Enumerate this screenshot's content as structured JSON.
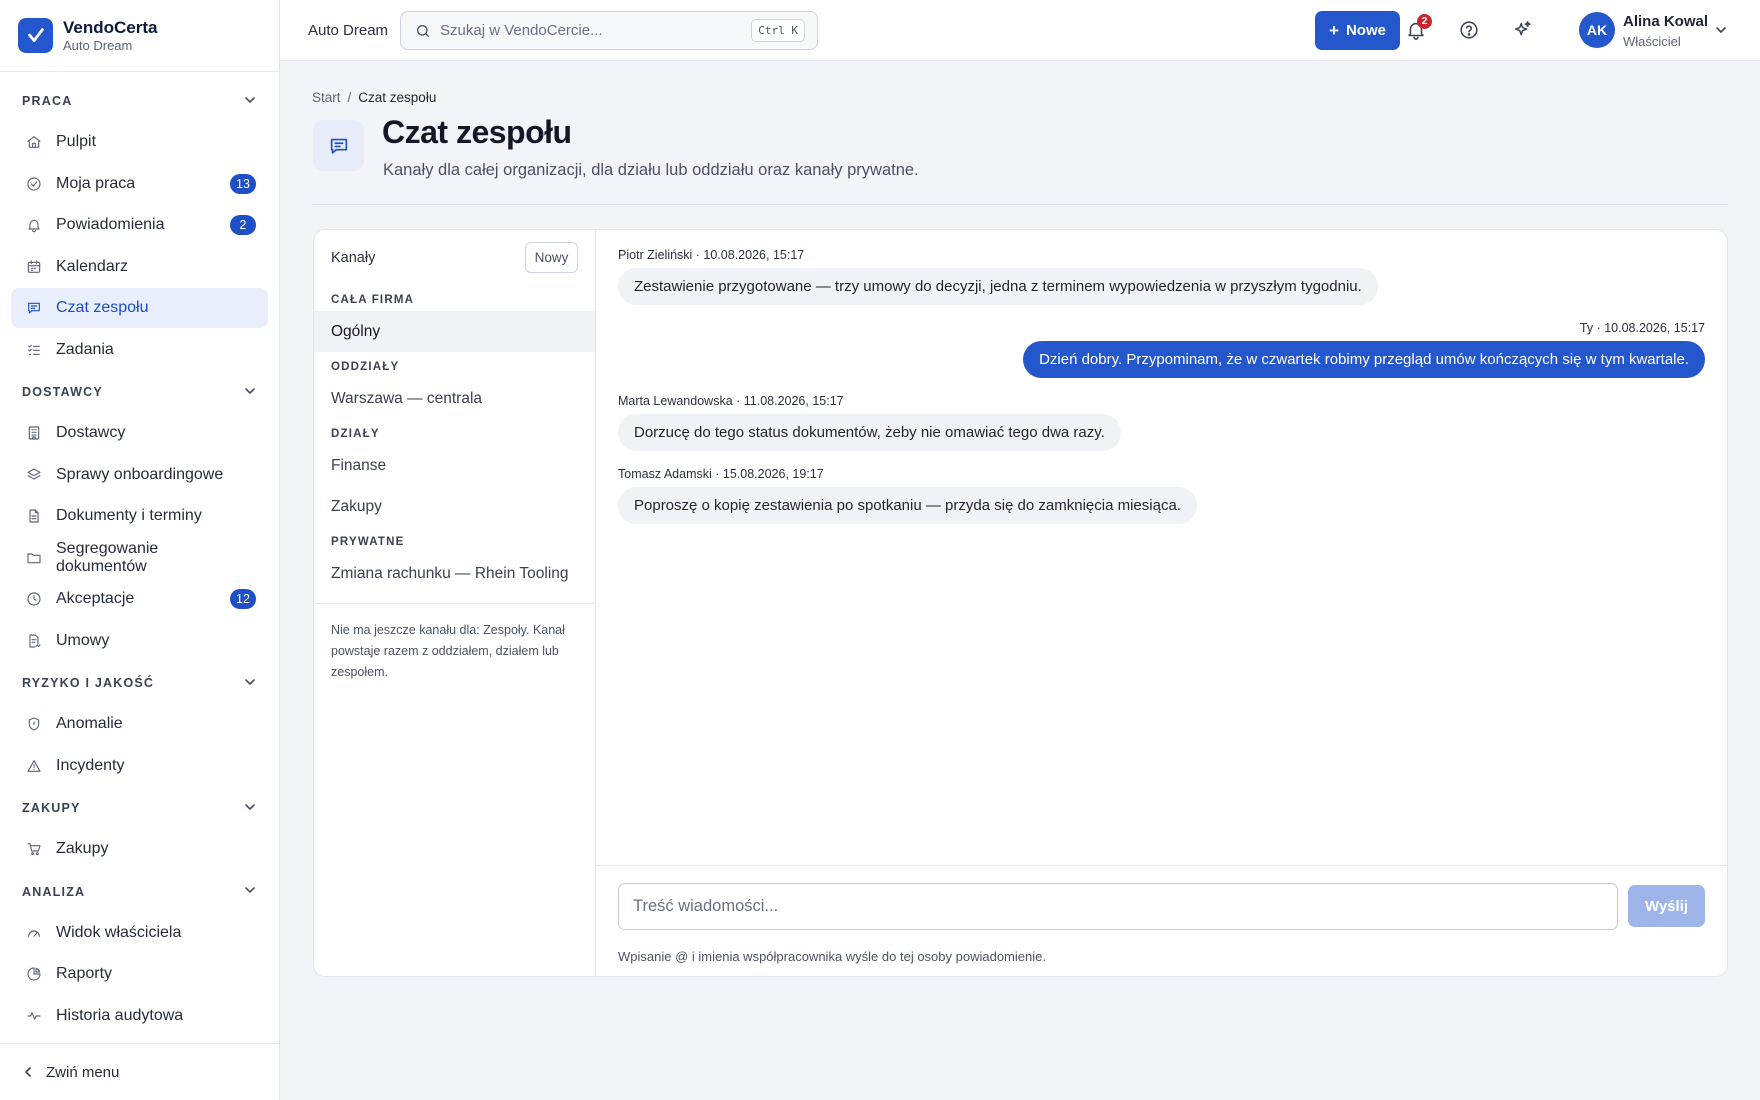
{
  "brand": {
    "name": "VendoCerta",
    "org": "Auto Dream"
  },
  "sidebar": {
    "sections": [
      {
        "label": "PRACA",
        "items": [
          {
            "label": "Pulpit",
            "icon": "home-icon"
          },
          {
            "label": "Moja praca",
            "icon": "check-circle-icon",
            "badge": "13"
          },
          {
            "label": "Powiadomienia",
            "icon": "bell-icon",
            "badge": "2"
          },
          {
            "label": "Kalendarz",
            "icon": "calendar-icon"
          },
          {
            "label": "Czat zespołu",
            "icon": "chat-icon",
            "active": true
          },
          {
            "label": "Zadania",
            "icon": "list-check-icon"
          }
        ]
      },
      {
        "label": "DOSTAWCY",
        "items": [
          {
            "label": "Dostawcy",
            "icon": "building-icon"
          },
          {
            "label": "Sprawy onboardingowe",
            "icon": "layers-icon"
          },
          {
            "label": "Dokumenty i terminy",
            "icon": "document-icon"
          },
          {
            "label": "Segregowanie dokumentów",
            "icon": "folder-icon"
          },
          {
            "label": "Akceptacje",
            "icon": "clock-icon",
            "badge": "12"
          },
          {
            "label": "Umowy",
            "icon": "contract-icon"
          }
        ]
      },
      {
        "label": "RYZYKO I JAKOŚĆ",
        "items": [
          {
            "label": "Anomalie",
            "icon": "shield-icon"
          },
          {
            "label": "Incydenty",
            "icon": "warning-icon"
          }
        ]
      },
      {
        "label": "ZAKUPY",
        "items": [
          {
            "label": "Zakupy",
            "icon": "cart-icon"
          }
        ]
      },
      {
        "label": "ANALIZA",
        "items": [
          {
            "label": "Widok właściciela",
            "icon": "gauge-icon"
          },
          {
            "label": "Raporty",
            "icon": "pie-chart-icon"
          },
          {
            "label": "Historia audytowa",
            "icon": "activity-icon"
          }
        ]
      }
    ],
    "collapse_label": "Zwiń menu"
  },
  "topbar": {
    "org": "Auto Dream",
    "search_placeholder": "Szukaj w VendoCercie...",
    "search_shortcut": "Ctrl K",
    "new_label": "Nowe",
    "notifications_count": "2",
    "user": {
      "initials": "AK",
      "name": "Alina Kowal",
      "role": "Właściciel"
    }
  },
  "page": {
    "breadcrumb": {
      "root": "Start",
      "current": "Czat zespołu"
    },
    "title": "Czat zespołu",
    "subtitle": "Kanały dla całej organizacji, dla działu lub oddziału oraz kanały prywatne."
  },
  "channels": {
    "header": "Kanały",
    "new_label": "Nowy",
    "groups": [
      {
        "label": "CAŁA FIRMA",
        "items": [
          {
            "label": "Ogólny",
            "active": true
          }
        ]
      },
      {
        "label": "ODDZIAŁY",
        "items": [
          {
            "label": "Warszawa — centrala"
          }
        ]
      },
      {
        "label": "DZIAŁY",
        "items": [
          {
            "label": "Finanse"
          },
          {
            "label": "Zakupy"
          }
        ]
      },
      {
        "label": "PRYWATNE",
        "items": [
          {
            "label": "Zmiana rachunku — Rhein Tooling"
          }
        ]
      }
    ],
    "note": "Nie ma jeszcze kanału dla: Zespoły. Kanał powstaje razem z oddziałem, działem lub zespołem."
  },
  "messages": [
    {
      "meta": "Piotr Zieliński · 10.08.2026, 15:17",
      "text": "Zestawienie przygotowane — trzy umowy do decyzji, jedna z terminem wypowiedzenia w przyszłym tygodniu.",
      "own": false
    },
    {
      "meta": "Ty · 10.08.2026, 15:17",
      "text": "Dzień dobry. Przypominam, że w czwartek robimy przegląd umów kończących się w tym kwartale.",
      "own": true
    },
    {
      "meta": "Marta Lewandowska · 11.08.2026, 15:17",
      "text": "Dorzucę do tego status dokumentów, żeby nie omawiać tego dwa razy.",
      "own": false
    },
    {
      "meta": "Tomasz Adamski · 15.08.2026, 19:17",
      "text": "Poproszę o kopię zestawienia po spotkaniu — przyda się do zamknięcia miesiąca.",
      "own": false
    }
  ],
  "composer": {
    "placeholder": "Treść wiadomości...",
    "send_label": "Wyślij",
    "hint": "Wpisanie @ i imienia współpracownika wyśle do tej osoby powiadomienie."
  }
}
